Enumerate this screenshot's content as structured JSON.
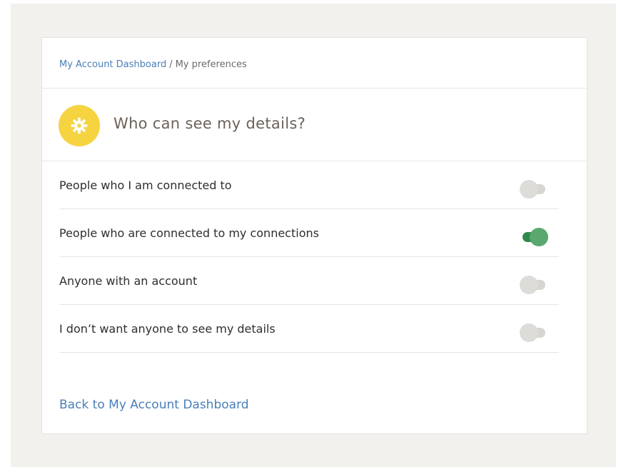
{
  "breadcrumb": {
    "home_label": "My Account Dashboard",
    "separator": "/",
    "current_label": "My preferences"
  },
  "header": {
    "icon": "gear-icon",
    "title": "Who can see my details?"
  },
  "options": [
    {
      "label": "People who I am connected to",
      "enabled": false
    },
    {
      "label": "People who are connected to my connections",
      "enabled": true
    },
    {
      "label": "Anyone with an account",
      "enabled": false
    },
    {
      "label": "I don’t want anyone to see my details",
      "enabled": false
    }
  ],
  "footer": {
    "back_label": "Back to My Account Dashboard"
  },
  "colors": {
    "accent_yellow": "#f6d340",
    "link_blue": "#4a7fb8",
    "toggle_on": "#2f8a4a",
    "toggle_off": "#d8d6d2"
  }
}
